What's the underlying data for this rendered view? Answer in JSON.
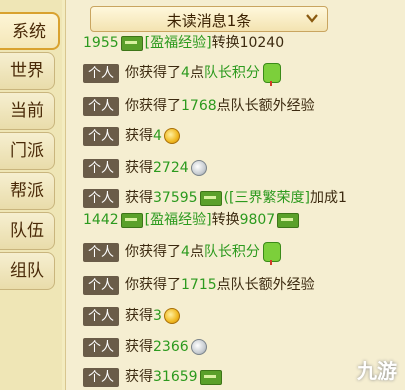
{
  "tabs": [
    {
      "label": "系统",
      "active": true
    },
    {
      "label": "世界"
    },
    {
      "label": "当前"
    },
    {
      "label": "门派"
    },
    {
      "label": "帮派"
    },
    {
      "label": "队伍"
    },
    {
      "label": "组队"
    }
  ],
  "header": {
    "title": "未读消息1条"
  },
  "messages": {
    "partial_top": {
      "pre": "1955",
      "mid": "[盈福经验]",
      "post": "转换10240"
    },
    "m1": {
      "badge": "个人",
      "pre": "你获得了",
      "num": "4",
      "unit": "点",
      "green": "队长积分"
    },
    "m2": {
      "badge": "个人",
      "pre": "你获得了",
      "num": "1768",
      "post": "点队长额外经验"
    },
    "m3": {
      "badge": "个人",
      "pre": "获得",
      "num": "4"
    },
    "m4": {
      "badge": "个人",
      "pre": "获得",
      "num": "2724"
    },
    "m5": {
      "badge": "个人",
      "pre": "获得",
      "num": "37595",
      "bracket": "([三界繁荣度]",
      "post": "加成1",
      "line2_num": "1442",
      "line2_bracket": "[盈福经验]",
      "line2_post": "转换",
      "line2_num2": "9807"
    },
    "m6": {
      "badge": "个人",
      "pre": "你获得了",
      "num": "4",
      "unit": "点",
      "green": "队长积分"
    },
    "m7": {
      "badge": "个人",
      "pre": "你获得了",
      "num": "1715",
      "post": "点队长额外经验"
    },
    "m8": {
      "badge": "个人",
      "pre": "获得",
      "num": "3"
    },
    "m9": {
      "badge": "个人",
      "pre": "获得",
      "num": "2366"
    },
    "m10": {
      "badge": "个人",
      "pre": "获得",
      "num": "31659"
    }
  },
  "watermark": "九游",
  "colors": {
    "green": "#2c9a1e",
    "badge": "#6a5c48",
    "tab_active_border": "#d9a22f"
  }
}
